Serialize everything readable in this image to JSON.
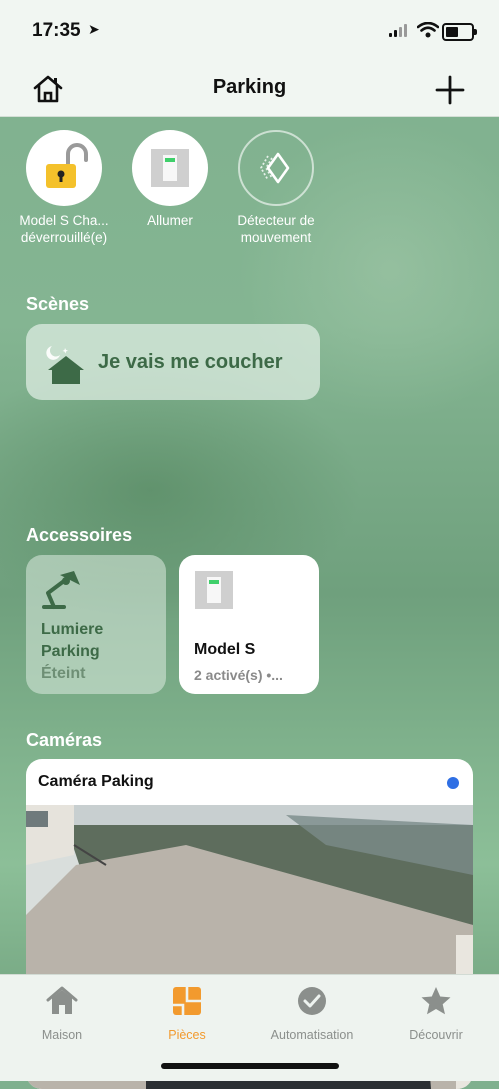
{
  "status": {
    "time": "17:35"
  },
  "navbar": {
    "title": "Parking"
  },
  "top_accessories": [
    {
      "label": "Model S Cha... déverrouillé(e)"
    },
    {
      "label": "Allumer"
    },
    {
      "label": "Détecteur de mouvement"
    }
  ],
  "scenes": {
    "heading": "Scènes",
    "items": [
      {
        "label": "Je vais me coucher"
      }
    ]
  },
  "accessories": {
    "heading": "Accessoires",
    "items": [
      {
        "name": "Lumiere Parking",
        "state": "Éteint"
      },
      {
        "name": "Model S",
        "state": "2 activé(s) •..."
      }
    ]
  },
  "cameras": {
    "heading": "Caméras",
    "items": [
      {
        "name": "Caméra Paking"
      }
    ]
  },
  "tabs": [
    {
      "label": "Maison",
      "icon": "house-icon"
    },
    {
      "label": "Pièces",
      "icon": "rooms-icon",
      "active": true
    },
    {
      "label": "Automatisation",
      "icon": "clock-check-icon"
    },
    {
      "label": "Découvrir",
      "icon": "star-icon"
    }
  ],
  "colors": {
    "accent": "#f29a2e",
    "scene_text": "#3d6a47",
    "camera_dot": "#2f6fe4"
  }
}
